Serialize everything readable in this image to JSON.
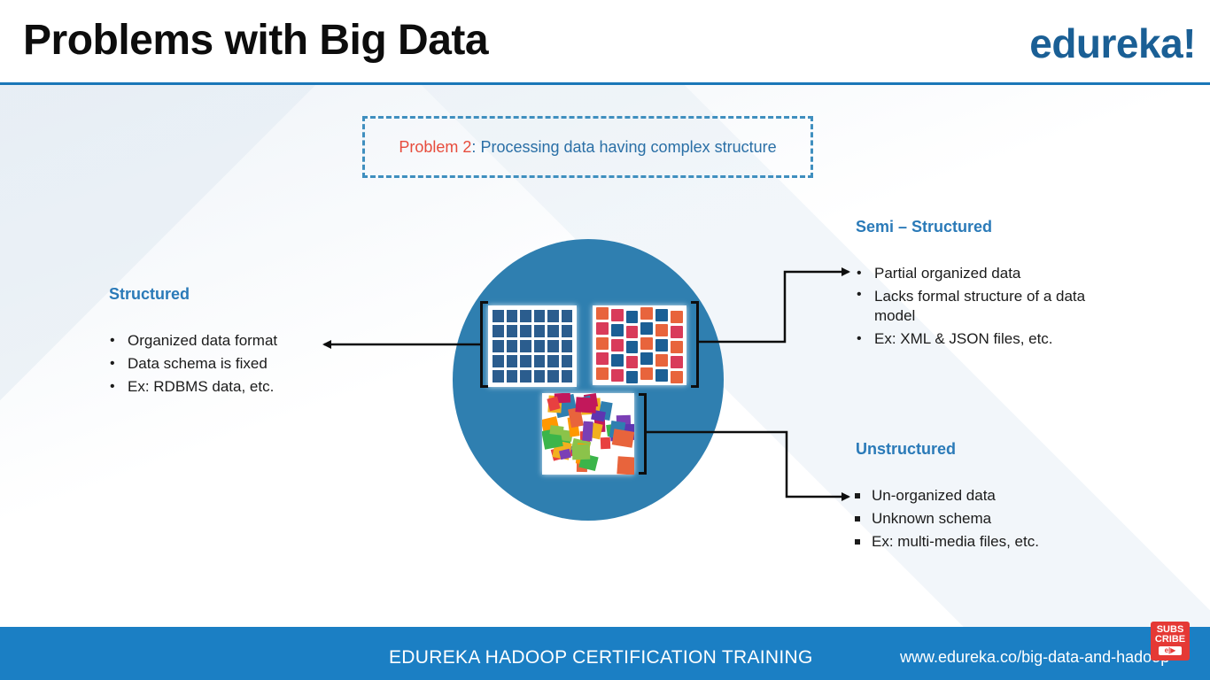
{
  "header": {
    "title": "Problems with Big Data",
    "logo": "edureka!"
  },
  "problem": {
    "label": "Problem 2",
    "separator": ":",
    "text": " Processing data having complex structure"
  },
  "structured": {
    "title": "Structured",
    "items": [
      "Organized data format",
      "Data schema is fixed",
      "Ex: RDBMS data, etc."
    ]
  },
  "semi_structured": {
    "title": "Semi – Structured",
    "items": [
      "Partial organized data",
      "Lacks formal structure of a data model",
      "Ex: XML & JSON files, etc."
    ]
  },
  "unstructured": {
    "title": "Unstructured",
    "items": [
      "Un-organized data",
      "Unknown schema",
      "Ex: multi-media files, etc."
    ]
  },
  "footer": {
    "title": "EDUREKA HADOOP CERTIFICATION TRAINING",
    "url": "www.edureka.co/big-data-and-hadoop"
  },
  "subscribe": {
    "line1": "SUBS",
    "line2": "CRIBE",
    "badge": "e|▶"
  },
  "colors": {
    "accent": "#1b7fc4",
    "heading_blue": "#2a7ab8",
    "problem_red": "#e74c3c",
    "circle": "#2f7fb0"
  }
}
